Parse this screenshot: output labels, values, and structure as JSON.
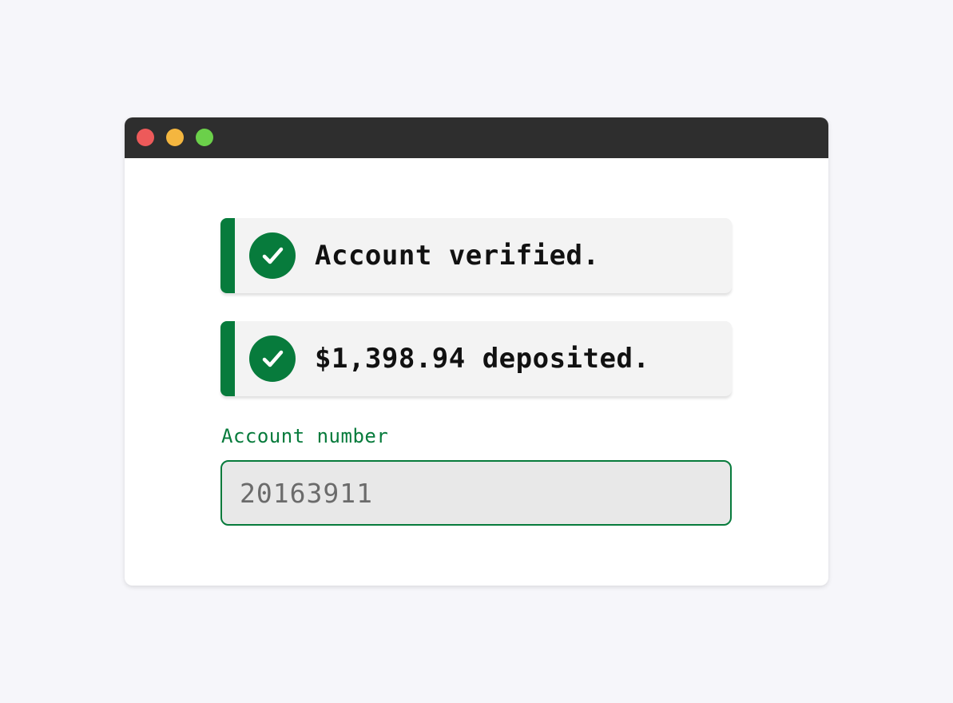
{
  "window": {
    "controls": [
      "close",
      "minimize",
      "maximize"
    ],
    "control_colors": {
      "close": "#ed5a5a",
      "minimize": "#f4b63f",
      "maximize": "#6bd04a"
    }
  },
  "alerts": [
    {
      "icon": "check-circle-icon",
      "message": "Account verified."
    },
    {
      "icon": "check-circle-icon",
      "message": "$1,398.94 deposited."
    }
  ],
  "account_field": {
    "label": "Account number",
    "value": "20163911"
  },
  "colors": {
    "accent": "#077b3c",
    "titlebar": "#2e2e2e",
    "background": "#f6f6fa"
  }
}
